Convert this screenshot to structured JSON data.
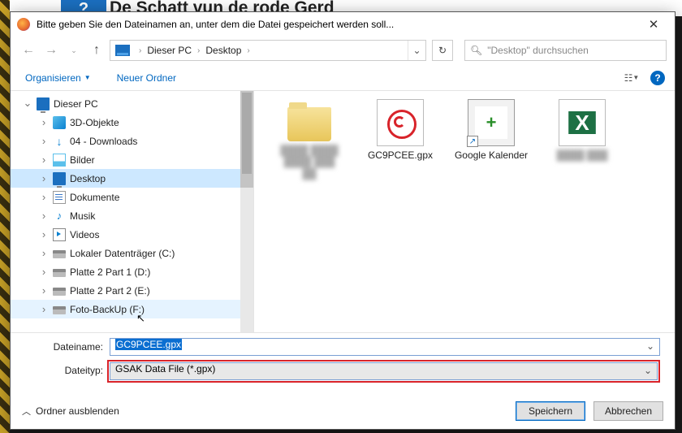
{
  "background": {
    "page_title": "De Schatt vun de rode Gerd"
  },
  "dialog": {
    "title": "Bitte geben Sie den Dateinamen an, unter dem die Datei gespeichert werden soll...",
    "path": {
      "seg1": "Dieser PC",
      "seg2": "Desktop"
    },
    "search_placeholder": "\"Desktop\" durchsuchen",
    "toolbar": {
      "organize": "Organisieren",
      "new_folder": "Neuer Ordner"
    },
    "tree": {
      "root": "Dieser PC",
      "items": [
        "3D-Objekte",
        "04 - Downloads",
        "Bilder",
        "Desktop",
        "Dokumente",
        "Musik",
        "Videos",
        "Lokaler Datenträger (C:)",
        "Platte 2 Part 1 (D:)",
        "Platte 2 Part 2 (E:)",
        "Foto-BackUp (F:)"
      ]
    },
    "files": {
      "item0": "redacted folder",
      "item1": "GC9PCEE.gpx",
      "item2": "Google Kalender",
      "item3": "redacted.xlsx"
    },
    "form": {
      "filename_label": "Dateiname:",
      "filename_value": "GC9PCEE.gpx",
      "filetype_label": "Dateityp:",
      "filetype_value": "GSAK Data File (*.gpx)"
    },
    "footer": {
      "hide_folders": "Ordner ausblenden",
      "save": "Speichern",
      "cancel": "Abbrechen"
    }
  }
}
